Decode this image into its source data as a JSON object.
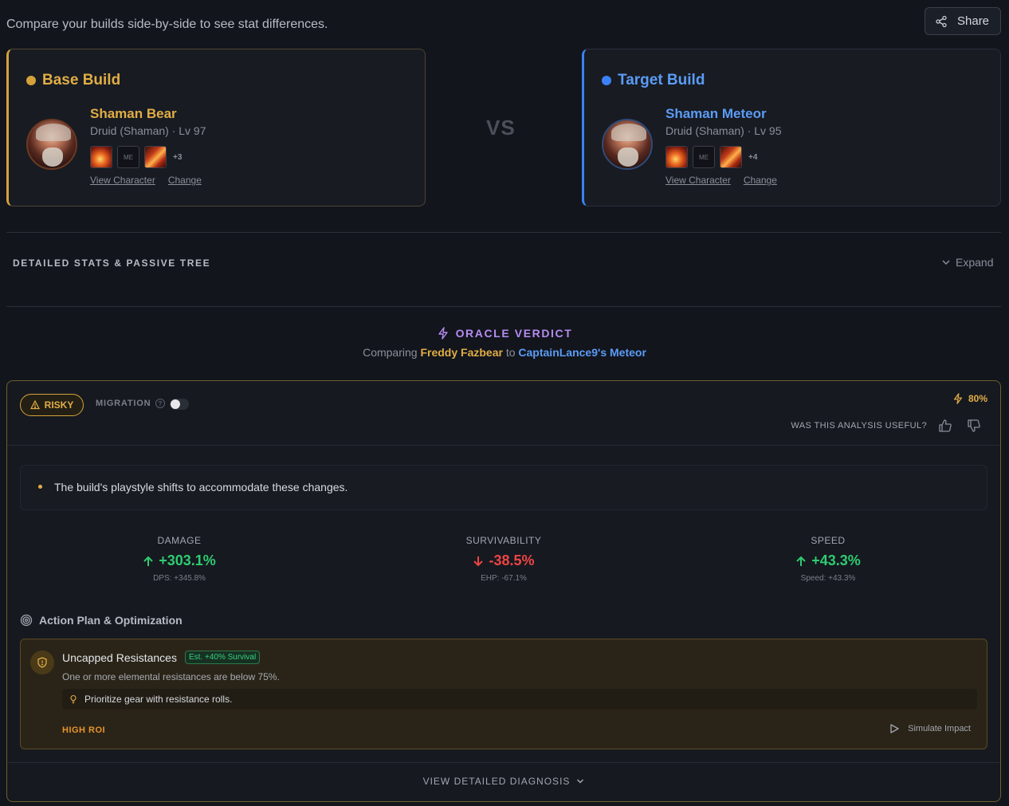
{
  "header": {
    "subtitle": "Compare your builds side-by-side to see stat differences.",
    "share_label": "Share"
  },
  "base_build": {
    "title": "Base Build",
    "char_name": "Shaman Bear",
    "char_class": "Druid (Shaman) · Lv 97",
    "skill_more": "+3",
    "skill_me_label": "ME",
    "view_label": "View Character",
    "change_label": "Change"
  },
  "vs_label": "VS",
  "target_build": {
    "title": "Target Build",
    "char_name": "Shaman Meteor",
    "char_class": "Druid (Shaman) · Lv 95",
    "skill_more": "+4",
    "skill_me_label": "ME",
    "view_label": "View Character",
    "change_label": "Change"
  },
  "details": {
    "title": "DETAILED STATS & PASSIVE TREE",
    "expand_label": "Expand"
  },
  "oracle": {
    "title": "ORACLE VERDICT",
    "comparing_prefix": "Comparing",
    "base_name": "Freddy Fazbear",
    "to_word": "to",
    "target_name": "CaptainLance9's Meteor"
  },
  "verdict": {
    "risk_label": "RISKY",
    "migration_label": "MIGRATION",
    "migration_on": false,
    "confidence": "80%",
    "useful_label": "WAS THIS ANALYSIS USEFUL?",
    "summary": "The build's playstyle shifts to accommodate these changes.",
    "metrics": [
      {
        "label": "DAMAGE",
        "value": "+303.1%",
        "sub": "DPS: +345.8%",
        "direction": "up"
      },
      {
        "label": "SURVIVABILITY",
        "value": "-38.5%",
        "sub": "EHP: -67.1%",
        "direction": "down"
      },
      {
        "label": "SPEED",
        "value": "+43.3%",
        "sub": "Speed: +43.3%",
        "direction": "up"
      }
    ],
    "plan_title": "Action Plan & Optimization",
    "plan": {
      "title": "Uncapped Resistances",
      "badge": "Est. +40% Survival",
      "desc": "One or more elemental resistances are below 75%.",
      "tip": "Prioritize gear with resistance rolls.",
      "roi": "HIGH ROI",
      "simulate_label": "Simulate Impact"
    },
    "diagnosis_label": "VIEW DETAILED DIAGNOSIS"
  },
  "colors": {
    "base_accent": "#d4a23a",
    "target_accent": "#3b82f6",
    "oracle_purple": "#b68cf0",
    "positive": "#2ecc71",
    "negative": "#ef4444"
  }
}
